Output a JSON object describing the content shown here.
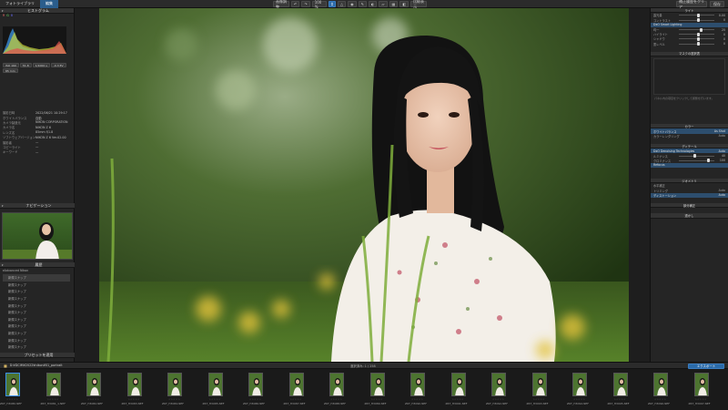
{
  "topbar": {
    "tabs": [
      "フォトライブラリ",
      "編集"
    ],
    "center_label": "画像調整",
    "zoom": "100 %",
    "compare_label": "比較表示",
    "right_items": [
      "補正履歴をクリア",
      "保存"
    ]
  },
  "left": {
    "header": "ヒストグラム",
    "rgb_labels": [
      "R",
      "G",
      "B"
    ],
    "buttons": [
      "ISO 160",
      "f/1.8",
      "1/1000 s",
      "-0.3 EV",
      "85 mm"
    ],
    "info_rows": [
      {
        "k": "撮影日時",
        "v": "2022/06/21 10:29:17"
      },
      {
        "k": "ホワイトバランス",
        "v": "自動"
      },
      {
        "k": "カメラ製造元",
        "v": "NIKON CORPORATION"
      },
      {
        "k": "カメラ名",
        "v": "NIKON Z 6"
      },
      {
        "k": "レンズ名",
        "v": "85mm f/1.8"
      },
      {
        "k": "ソフトウェアバージョン",
        "v": "NIKON Z 6 Ver.02.00"
      },
      {
        "k": "撮影者",
        "v": "—"
      },
      {
        "k": "コピーライト",
        "v": "—"
      },
      {
        "k": "キーワード",
        "v": "—"
      }
    ],
    "nav_header": "ナビゲーション",
    "presets_header": "履歴",
    "preset_group": "Advanced Nikon",
    "presets": [
      "新規スナップ",
      "新規スナップ",
      "新規スナップ",
      "新規スナップ",
      "新規スナップ",
      "新規スナップ",
      "新規スナップ",
      "新規スナップ",
      "新規スナップ",
      "新規スナップ",
      "新規スナップ"
    ],
    "footer": "プリセットを適用"
  },
  "right": {
    "sections": [
      {
        "title": "ライト",
        "rows": [
          {
            "label": "露光量",
            "value": "0.00"
          },
          {
            "label": "コントラスト",
            "value": "0"
          }
        ]
      },
      {
        "title": "DxO Smart Lighting",
        "rows": [
          {
            "label": "均一",
            "value": "25"
          },
          {
            "label": "ハイライト",
            "value": "0"
          },
          {
            "label": "シャドウ",
            "value": "0"
          },
          {
            "label": "黒レベル",
            "value": "0"
          }
        ]
      },
      {
        "title": "マスクの選択表",
        "rows": []
      },
      {
        "title": "カラー",
        "rows": [
          {
            "label": "ホワイトバランス",
            "value": "As Shot"
          },
          {
            "label": "カラーレンダリング",
            "value": "Auto"
          }
        ]
      },
      {
        "title": "ディテール",
        "rows": [
          {
            "label": "DxO Denoising Technologies",
            "value": "Auto"
          },
          {
            "label": "ルミナンス",
            "value": "40"
          },
          {
            "label": "クロミナンス",
            "value": "100"
          },
          {
            "label": "Refocus",
            "value": ""
          }
        ]
      },
      {
        "title": "ジオメトリ",
        "rows": [
          {
            "label": "水平補正",
            "value": ""
          },
          {
            "label": "トリミング",
            "value": "Auto"
          },
          {
            "label": "ディストーション",
            "value": "Auto"
          }
        ]
      },
      {
        "title": "部分補正",
        "rows": []
      },
      {
        "title": "透かし",
        "rows": []
      }
    ],
    "hint": "パネル内の項目をクリックして調整を行います。"
  },
  "filmbar": {
    "path": "D:¥DCIM¥2022¥nikon¥01_portrait",
    "count": "選択済み: 1 / 258",
    "right_label": "エクスポート"
  },
  "filmstrip": [
    {
      "name": "Z6T_H3080.NEF"
    },
    {
      "name": "Z6T_H3081_1.NEF"
    },
    {
      "name": "Z6T_H3082.NEF"
    },
    {
      "name": "Z6T_H3083.NEF"
    },
    {
      "name": "Z6T_H3084.NEF"
    },
    {
      "name": "Z6T_H3085.NEF"
    },
    {
      "name": "Z6T_H3086.NEF"
    },
    {
      "name": "Z6T_H3087.NEF"
    },
    {
      "name": "Z6T_H3088.NEF"
    },
    {
      "name": "Z6T_H3089.NEF"
    },
    {
      "name": "Z6T_H3090.NEF"
    },
    {
      "name": "Z6T_H3091.NEF"
    },
    {
      "name": "Z6T_H3092.NEF"
    },
    {
      "name": "Z6T_H3093.NEF"
    },
    {
      "name": "Z6T_H3094.NEF"
    },
    {
      "name": "Z6T_H3095.NEF"
    },
    {
      "name": "Z6T_H3096.NEF"
    },
    {
      "name": "Z6T_H3097.NEF"
    }
  ],
  "colors": {
    "accent": "#2b6aa8",
    "selection": "#2d4e6e",
    "panel": "#252525"
  }
}
